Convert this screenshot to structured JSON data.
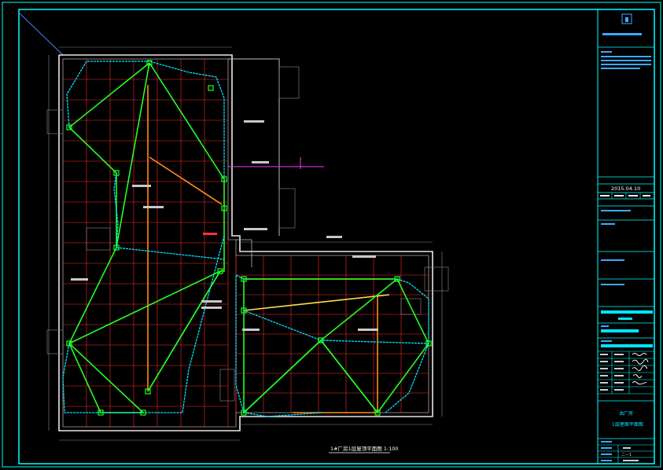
{
  "title_block": {
    "date": "2015.04.10",
    "project": "油厂房",
    "drawing_name": "1层屋面平面图",
    "sheet_no": "二—1"
  },
  "plan_caption": "1#厂房1层屋顶平面图 1:100",
  "colors": {
    "border": "#00ffff",
    "wall": "#ffffff",
    "grid": "#ff2a2a",
    "pipe_green": "#22ff22",
    "pipe_cyan": "#00e5ff",
    "pipe_orange": "#ff8c1a",
    "pipe_yellow": "#ffe14a",
    "pipe_magenta": "#ff33ff"
  }
}
